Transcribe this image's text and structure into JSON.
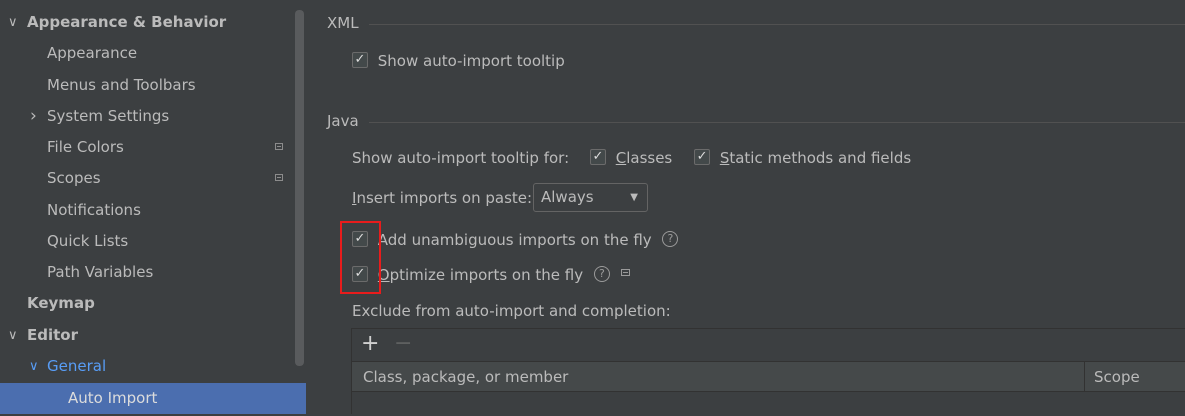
{
  "sidebar": {
    "items": [
      {
        "label": "Appearance & Behavior",
        "chevron": "∨"
      },
      {
        "label": "Appearance"
      },
      {
        "label": "Menus and Toolbars"
      },
      {
        "label": "System Settings",
        "chevron": "›"
      },
      {
        "label": "File Colors"
      },
      {
        "label": "Scopes"
      },
      {
        "label": "Notifications"
      },
      {
        "label": "Quick Lists"
      },
      {
        "label": "Path Variables"
      },
      {
        "label": "Keymap"
      },
      {
        "label": "Editor",
        "chevron": "∨"
      },
      {
        "label": "General",
        "chevron": "∨"
      },
      {
        "label": "Auto Import"
      }
    ]
  },
  "xml": {
    "title": "XML",
    "show_tooltip": {
      "label": "Show auto-import tooltip",
      "checked": true
    }
  },
  "java": {
    "title": "Java",
    "tooltip_for_label": "Show auto-import tooltip for:",
    "classes": {
      "mnemonic": "C",
      "rest": "lasses",
      "checked": true
    },
    "static": {
      "mnemonic": "S",
      "rest": "tatic methods and fields",
      "checked": true
    },
    "paste_label": {
      "mnemonic": "I",
      "rest": "nsert imports on paste:"
    },
    "paste_value": "Always",
    "add_unambiguous": {
      "label": "Add unambiguous imports on the fly",
      "checked": true
    },
    "optimize": {
      "mnemonic": "O",
      "rest": "ptimize imports on the fly",
      "checked": true
    },
    "exclude_label": "Exclude from auto-import and completion:"
  },
  "table": {
    "add": "+",
    "remove": "−",
    "columns": [
      "Class, package, or member",
      "Scope"
    ]
  },
  "glyphs": {
    "check": "✓",
    "help": "?",
    "dropdown_arrow": "▼"
  },
  "colors": {
    "selection": "#4b6eaf",
    "link_blue": "#589df6",
    "highlight_box": "#e81c1c",
    "background": "#3c3f41"
  }
}
